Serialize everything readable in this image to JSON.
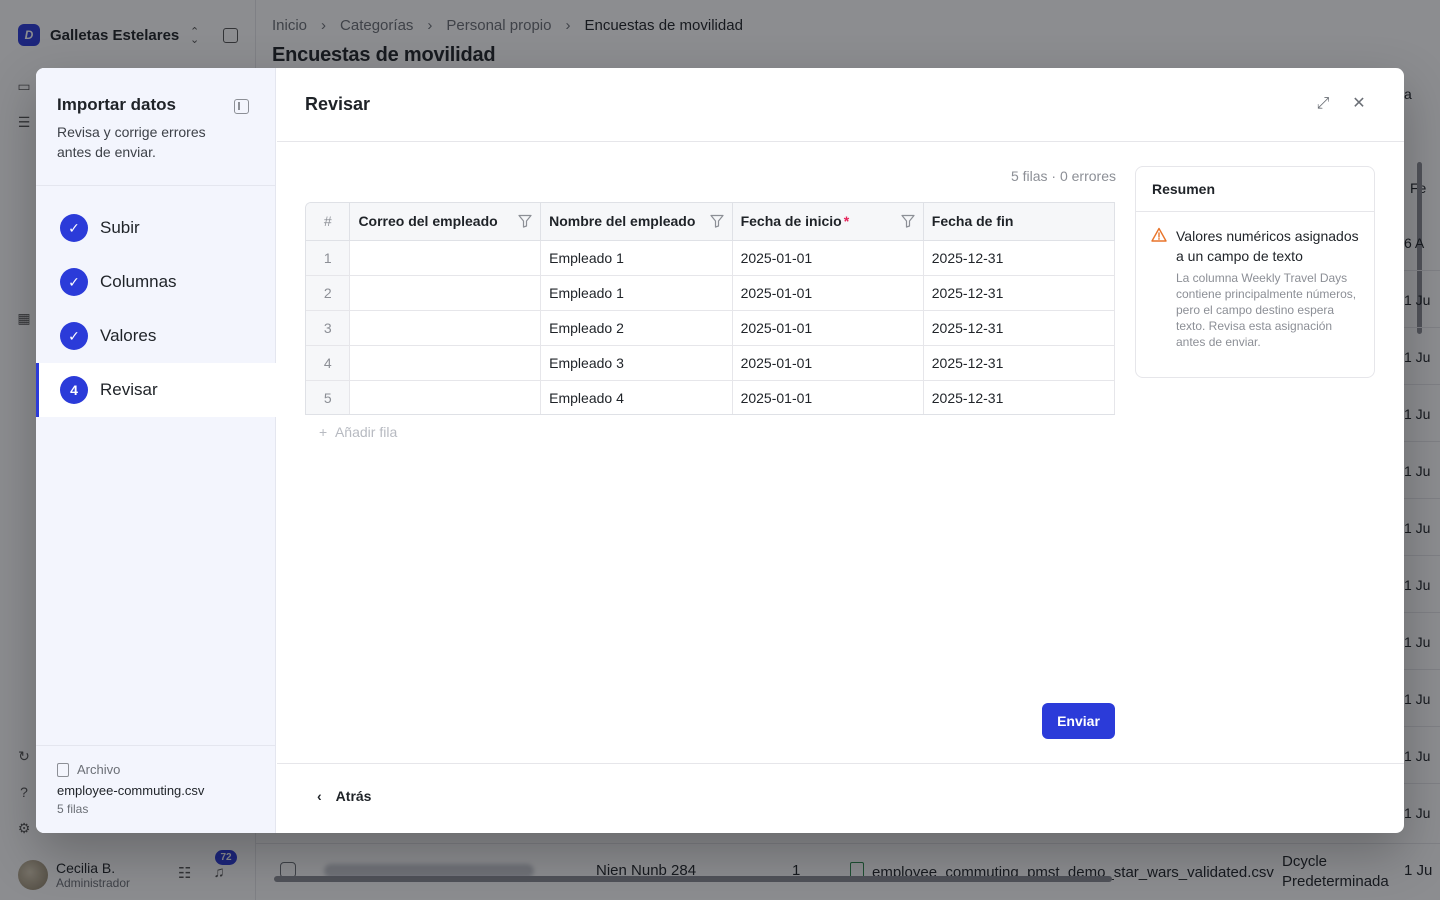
{
  "app": {
    "org_name": "Galletas Estelares",
    "org_logo_letter": "D",
    "user_name": "Cecilia B.",
    "user_role": "Administrador",
    "notification_count": "72"
  },
  "page": {
    "breadcrumb": [
      "Inicio",
      "Categorías",
      "Personal propio",
      "Encuestas de movilidad"
    ],
    "title": "Encuestas de movilidad"
  },
  "background_row": {
    "name": "Nien Nunb 284",
    "count": "1",
    "file": "employee_commuting_pmst_demo_star_wars_validated.csv",
    "method_line1": "Dcycle",
    "method_line2": "Predeterminada",
    "date_fragment": "1 Ju"
  },
  "background_right": {
    "header_fragment": "Fe",
    "button_fragment": "a",
    "first_cell": "6 A",
    "cells": [
      "1 Ju",
      "1 Ju",
      "1 Ju",
      "1 Ju",
      "1 Ju",
      "1 Ju",
      "1 Ju",
      "1 Ju",
      "1 Ju",
      "1 Ju"
    ]
  },
  "wizard": {
    "title": "Importar datos",
    "subtitle": "Revisa y corrige errores antes de enviar.",
    "steps": [
      {
        "label": "Subir",
        "state": "done"
      },
      {
        "label": "Columnas",
        "state": "done"
      },
      {
        "label": "Valores",
        "state": "done"
      },
      {
        "label": "Revisar",
        "state": "active",
        "number": "4"
      }
    ],
    "file_label": "Archivo",
    "file_name": "employee-commuting.csv",
    "file_rows": "5 filas"
  },
  "review": {
    "title": "Revisar",
    "counts": "5 filas · 0 errores",
    "columns": [
      "#",
      "Correo del empleado",
      "Nombre del empleado",
      "Fecha de inicio",
      "Fecha de fin"
    ],
    "required_mark": "*",
    "rows": [
      [
        "1",
        "",
        "Empleado 1",
        "2025-01-01",
        "2025-12-31"
      ],
      [
        "2",
        "",
        "Empleado 1",
        "2025-01-01",
        "2025-12-31"
      ],
      [
        "3",
        "",
        "Empleado 2",
        "2025-01-01",
        "2025-12-31"
      ],
      [
        "4",
        "",
        "Empleado 3",
        "2025-01-01",
        "2025-12-31"
      ],
      [
        "5",
        "",
        "Empleado 4",
        "2025-01-01",
        "2025-12-31"
      ]
    ],
    "add_row": "Añadir fila",
    "submit": "Enviar",
    "back": "Atrás"
  },
  "summary": {
    "title": "Resumen",
    "warning_title": "Valores numéricos asignados a un campo de texto",
    "warning_desc": "La columna Weekly Travel Days contiene principalmente números, pero el campo destino espera texto. Revisa esta asignación antes de enviar."
  },
  "colors": {
    "accent": "#2b3bd9",
    "warning": "#e8742a",
    "required": "#e5245a"
  }
}
